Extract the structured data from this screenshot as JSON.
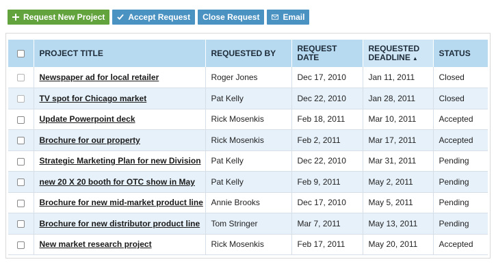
{
  "toolbar": {
    "request_new_label": "Request New Project",
    "accept_label": "Accept Request",
    "close_label": "Close Request",
    "email_label": "Email"
  },
  "table": {
    "headers": {
      "title": "PROJECT TITLE",
      "requested_by": "REQUESTED BY",
      "request_date_1": "REQUEST",
      "request_date_2": "DATE",
      "deadline_1": "REQUESTED",
      "deadline_2": "DEADLINE",
      "status": "STATUS"
    },
    "rows": [
      {
        "title": "Newspaper ad for local retailer",
        "by": "Roger Jones",
        "date": "Dec 17, 2010",
        "deadline": "Jan 11, 2011",
        "status": "Closed"
      },
      {
        "title": "TV spot for Chicago market",
        "by": "Pat Kelly",
        "date": "Dec 22, 2010",
        "deadline": "Jan 28, 2011",
        "status": "Closed"
      },
      {
        "title": "Update Powerpoint deck",
        "by": "Rick Mosenkis",
        "date": "Feb 18, 2011",
        "deadline": "Mar 10, 2011",
        "status": "Accepted"
      },
      {
        "title": "Brochure for our property",
        "by": "Rick Mosenkis",
        "date": "Feb 2, 2011",
        "deadline": "Mar 17, 2011",
        "status": "Accepted"
      },
      {
        "title": "Strategic Marketing Plan for new Division",
        "by": "Pat Kelly",
        "date": "Dec 22, 2010",
        "deadline": "Mar 31, 2011",
        "status": "Pending"
      },
      {
        "title": "new 20 X 20 booth for OTC show in May",
        "by": "Pat Kelly",
        "date": "Feb 9, 2011",
        "deadline": "May 2, 2011",
        "status": "Pending"
      },
      {
        "title": "Brochure for new mid-market product line",
        "by": "Annie Brooks",
        "date": "Dec 17, 2010",
        "deadline": "May 5, 2011",
        "status": "Pending"
      },
      {
        "title": "Brochure for new distributor product line",
        "by": "Tom Stringer",
        "date": "Mar 7, 2011",
        "deadline": "May 13, 2011",
        "status": "Pending"
      },
      {
        "title": "New market research project",
        "by": "Rick Mosenkis",
        "date": "Feb 17, 2011",
        "deadline": "May 20, 2011",
        "status": "Accepted"
      }
    ]
  }
}
